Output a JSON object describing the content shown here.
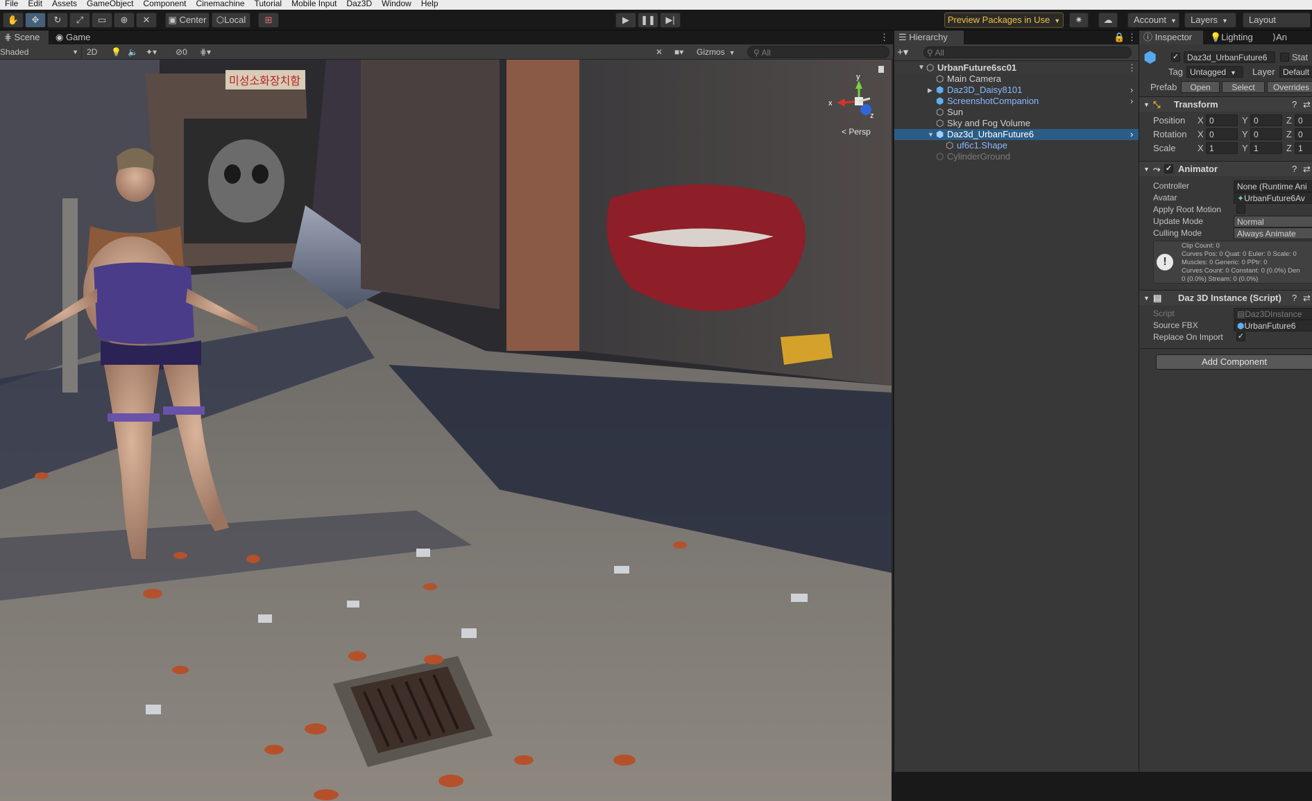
{
  "menu": [
    "File",
    "Edit",
    "Assets",
    "GameObject",
    "Component",
    "Cinemachine",
    "Tutorial",
    "Mobile Input",
    "Daz3D",
    "Window",
    "Help"
  ],
  "toolbar": {
    "pivot_label": "Center",
    "space_label": "Local",
    "preview_packages": "Preview Packages in Use",
    "account": "Account",
    "layers": "Layers",
    "layout": "Layout"
  },
  "scene": {
    "tabs": [
      "Scene",
      "Game"
    ],
    "shading_mode": "Shaded",
    "mode_2d": "2D",
    "hidden_count": "0",
    "gizmos": "Gizmos",
    "search_placeholder": "All",
    "persp_label": "Persp",
    "axis_x": "x",
    "axis_y": "y",
    "axis_z": "z",
    "sign_text": "미성소화장치함"
  },
  "hierarchy": {
    "title": "Hierarchy",
    "search_placeholder": "All",
    "root": "UrbanFuture6sc01",
    "items": [
      {
        "label": "Main Camera",
        "style": "normal"
      },
      {
        "label": "Daz3D_Daisy8101",
        "style": "prefab"
      },
      {
        "label": "ScreenshotCompanion",
        "style": "prefab"
      },
      {
        "label": "Sun",
        "style": "normal"
      },
      {
        "label": "Sky and Fog Volume",
        "style": "normal"
      },
      {
        "label": "Daz3d_UrbanFuture6",
        "style": "selected"
      },
      {
        "label": "uf6c1.Shape",
        "style": "prefab"
      },
      {
        "label": "CylinderGround",
        "style": "disabled"
      }
    ]
  },
  "inspector": {
    "tabs": [
      "Inspector",
      "Lighting",
      "An"
    ],
    "object_name": "Daz3d_UrbanFuture6",
    "static_label": "Stat",
    "tag_label": "Tag",
    "tag_value": "Untagged",
    "layer_label": "Layer",
    "layer_value": "Default",
    "prefab_label": "Prefab",
    "prefab_open": "Open",
    "prefab_select": "Select",
    "prefab_overrides": "Overrides",
    "transform": {
      "title": "Transform",
      "rows": [
        {
          "label": "Position",
          "x": "0",
          "y": "0",
          "z": "0"
        },
        {
          "label": "Rotation",
          "x": "0",
          "y": "0",
          "z": "0"
        },
        {
          "label": "Scale",
          "x": "1",
          "y": "1",
          "z": "1"
        }
      ]
    },
    "animator": {
      "title": "Animator",
      "controller_label": "Controller",
      "controller_value": "None (Runtime Ani",
      "avatar_label": "Avatar",
      "avatar_value": "UrbanFuture6Av",
      "root_motion_label": "Apply Root Motion",
      "update_mode_label": "Update Mode",
      "update_mode_value": "Normal",
      "culling_label": "Culling Mode",
      "culling_value": "Always Animate",
      "info": [
        "Clip Count: 0",
        "Curves Pos: 0 Quat: 0 Euler: 0 Scale: 0",
        "Muscles: 0 Generic: 0 PPtr: 0",
        "Curves Count: 0 Constant: 0 (0.0%) Den",
        "0 (0.0%) Stream: 0 (0.0%)"
      ]
    },
    "daz": {
      "title": "Daz 3D Instance (Script)",
      "script_label": "Script",
      "script_value": "Daz3DInstance",
      "source_label": "Source FBX",
      "source_value": "UrbanFuture6",
      "replace_label": "Replace On Import"
    },
    "add_component": "Add Component"
  }
}
